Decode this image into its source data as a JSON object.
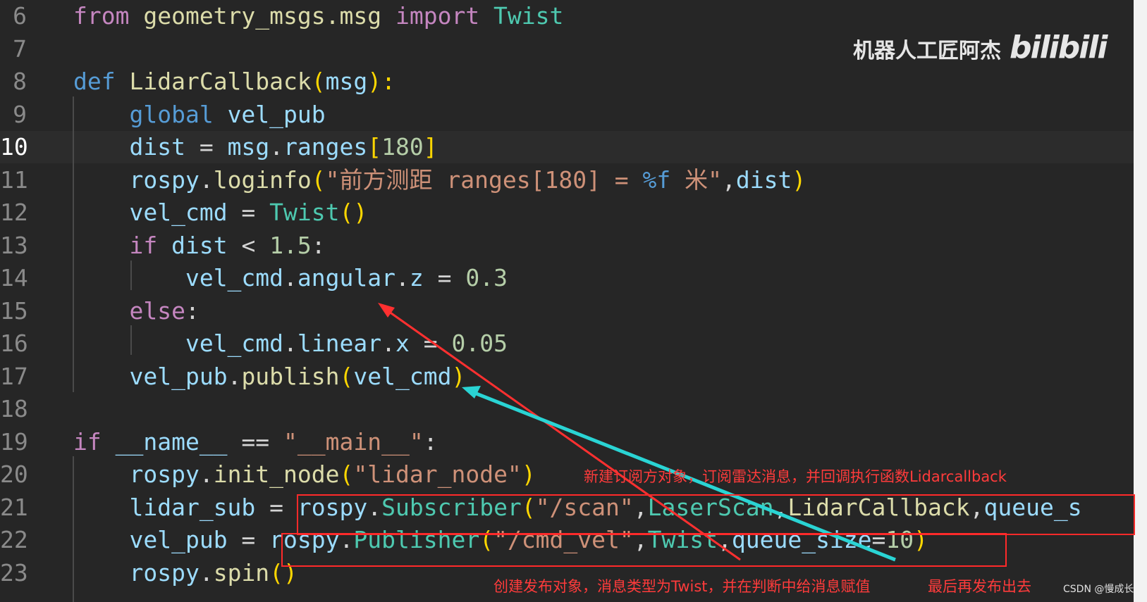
{
  "editor": {
    "lines": [
      {
        "num": "6",
        "tokens": [
          [
            "kw",
            "from "
          ],
          [
            "fn",
            "geometry_msgs.msg "
          ],
          [
            "kw",
            "import "
          ],
          [
            "cls",
            "Twist"
          ]
        ]
      },
      {
        "num": "7",
        "tokens": []
      },
      {
        "num": "8",
        "tokens": [
          [
            "kwd",
            "def "
          ],
          [
            "fn",
            "LidarCallback"
          ],
          [
            "paren",
            "("
          ],
          [
            "var",
            "msg"
          ],
          [
            "paren",
            "):"
          ]
        ]
      },
      {
        "num": "9",
        "tokens": [
          [
            "op",
            "    "
          ],
          [
            "kwd",
            "global "
          ],
          [
            "var",
            "vel_pub"
          ]
        ]
      },
      {
        "num": "10",
        "tokens": [
          [
            "op",
            "    "
          ],
          [
            "var",
            "dist"
          ],
          [
            "op",
            " = "
          ],
          [
            "var",
            "msg"
          ],
          [
            "op",
            "."
          ],
          [
            "var",
            "ranges"
          ],
          [
            "paren",
            "["
          ],
          [
            "num",
            "180"
          ],
          [
            "paren",
            "]"
          ]
        ]
      },
      {
        "num": "11",
        "tokens": [
          [
            "op",
            "    "
          ],
          [
            "var",
            "rospy"
          ],
          [
            "op",
            "."
          ],
          [
            "fn",
            "loginfo"
          ],
          [
            "paren",
            "("
          ],
          [
            "str",
            "\"前方测距 ranges[180] = "
          ],
          [
            "fmt",
            "%f"
          ],
          [
            "str",
            " 米\""
          ],
          [
            "op",
            ","
          ],
          [
            "var",
            "dist"
          ],
          [
            "paren",
            ")"
          ]
        ]
      },
      {
        "num": "12",
        "tokens": [
          [
            "op",
            "    "
          ],
          [
            "var",
            "vel_cmd"
          ],
          [
            "op",
            " = "
          ],
          [
            "cls",
            "Twist"
          ],
          [
            "paren",
            "()"
          ]
        ]
      },
      {
        "num": "13",
        "tokens": [
          [
            "op",
            "    "
          ],
          [
            "kw",
            "if "
          ],
          [
            "var",
            "dist"
          ],
          [
            "op",
            " < "
          ],
          [
            "num",
            "1.5"
          ],
          [
            "op",
            ":"
          ]
        ]
      },
      {
        "num": "14",
        "tokens": [
          [
            "op",
            "        "
          ],
          [
            "var",
            "vel_cmd"
          ],
          [
            "op",
            "."
          ],
          [
            "var",
            "angular"
          ],
          [
            "op",
            "."
          ],
          [
            "var",
            "z"
          ],
          [
            "op",
            " = "
          ],
          [
            "num",
            "0.3"
          ]
        ]
      },
      {
        "num": "15",
        "tokens": [
          [
            "op",
            "    "
          ],
          [
            "kw",
            "else"
          ],
          [
            "op",
            ":"
          ]
        ]
      },
      {
        "num": "16",
        "tokens": [
          [
            "op",
            "        "
          ],
          [
            "var",
            "vel_cmd"
          ],
          [
            "op",
            "."
          ],
          [
            "var",
            "linear"
          ],
          [
            "op",
            "."
          ],
          [
            "var",
            "x"
          ],
          [
            "op",
            " = "
          ],
          [
            "num",
            "0.05"
          ]
        ]
      },
      {
        "num": "17",
        "tokens": [
          [
            "op",
            "    "
          ],
          [
            "var",
            "vel_pub"
          ],
          [
            "op",
            "."
          ],
          [
            "fn",
            "publish"
          ],
          [
            "paren",
            "("
          ],
          [
            "var",
            "vel_cmd"
          ],
          [
            "paren",
            ")"
          ]
        ]
      },
      {
        "num": "18",
        "tokens": []
      },
      {
        "num": "19",
        "tokens": [
          [
            "kw",
            "if "
          ],
          [
            "var",
            "__name__"
          ],
          [
            "op",
            " == "
          ],
          [
            "str",
            "\"__main__\""
          ],
          [
            "op",
            ":"
          ]
        ]
      },
      {
        "num": "20",
        "tokens": [
          [
            "op",
            "    "
          ],
          [
            "var",
            "rospy"
          ],
          [
            "op",
            "."
          ],
          [
            "fn",
            "init_node"
          ],
          [
            "paren",
            "("
          ],
          [
            "str",
            "\"lidar_node\""
          ],
          [
            "paren",
            ")"
          ]
        ]
      },
      {
        "num": "21",
        "tokens": [
          [
            "op",
            "    "
          ],
          [
            "var",
            "lidar_sub"
          ],
          [
            "op",
            " = "
          ],
          [
            "var",
            "rospy"
          ],
          [
            "op",
            "."
          ],
          [
            "cls",
            "Subscriber"
          ],
          [
            "paren",
            "("
          ],
          [
            "str",
            "\"/scan\""
          ],
          [
            "op",
            ","
          ],
          [
            "cls",
            "LaserScan"
          ],
          [
            "op",
            ","
          ],
          [
            "fn",
            "LidarCallback"
          ],
          [
            "op",
            ","
          ],
          [
            "var",
            "queue_s"
          ]
        ]
      },
      {
        "num": "22",
        "tokens": [
          [
            "op",
            "    "
          ],
          [
            "var",
            "vel_pub"
          ],
          [
            "op",
            " = "
          ],
          [
            "var",
            "rospy"
          ],
          [
            "op",
            "."
          ],
          [
            "cls",
            "Publisher"
          ],
          [
            "paren",
            "("
          ],
          [
            "str",
            "\"/cmd_vel\""
          ],
          [
            "op",
            ","
          ],
          [
            "cls",
            "Twist"
          ],
          [
            "op",
            ","
          ],
          [
            "var",
            "queue_size"
          ],
          [
            "op",
            "="
          ],
          [
            "num",
            "10"
          ],
          [
            "paren",
            ")"
          ]
        ]
      },
      {
        "num": "23",
        "tokens": [
          [
            "op",
            "    "
          ],
          [
            "var",
            "rospy"
          ],
          [
            "op",
            "."
          ],
          [
            "fn",
            "spin"
          ],
          [
            "paren",
            "()"
          ]
        ]
      }
    ],
    "current_line": "10"
  },
  "annotations": {
    "subscriber_note": "新建订阅方对象，订阅雷达消息，并回调执行函数Lidarcallback",
    "publisher_note": "创建发布对象，消息类型为Twist，并在判断中给消息赋值",
    "publish_note": "最后再发布出去"
  },
  "watermark": {
    "author": "机器人工匠阿杰",
    "logo": "bilibili"
  },
  "csdn_credit": "CSDN @慢成长",
  "colors": {
    "arrow_red": "#ff3030",
    "arrow_cyan": "#2ad4d4",
    "box_red": "#ff2a2a"
  }
}
